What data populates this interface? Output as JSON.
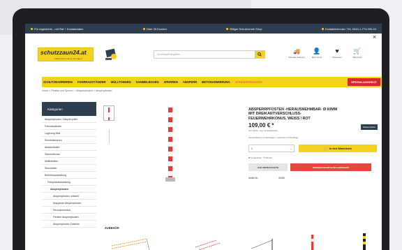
{
  "topbar": {
    "items": [
      "Für registrierte - mit Rat + Kontaktdaten",
      "Über 25 Kunden",
      "Billiger Schutzrunde Shop",
      "Kontaktformular / Tel. 0043-1-774-999-24"
    ]
  },
  "header": {
    "logo_text": "schutzzaun24.at",
    "logo_tagline": "... selbst eine Lösung auf Lager!",
    "search_placeholder": "Suchbegriff eingeben ...",
    "icons": [
      {
        "name": "truck-icon",
        "glyph": "🚚",
        "label": "Schnelle Lieferung"
      },
      {
        "name": "user-icon",
        "glyph": "👤",
        "label": "Mein Konto"
      },
      {
        "name": "heart-icon",
        "glyph": "♥",
        "label": "Merkzettel"
      },
      {
        "name": "cart-icon",
        "glyph": "🛒",
        "label": "Warenkorb"
      }
    ]
  },
  "nav": {
    "items": [
      {
        "label": "SCHUTZBARRIEREN",
        "color": "normal"
      },
      {
        "label": "FAHRRADSTÄNDER",
        "color": "normal"
      },
      {
        "label": "MÜLLTONNEN",
        "color": "normal"
      },
      {
        "label": "SAMMELBOXEN",
        "color": "normal"
      },
      {
        "label": "SPERREN",
        "color": "normal"
      },
      {
        "label": "ABSPERR",
        "color": "normal"
      },
      {
        "label": "BETONARMIERUNG",
        "color": "normal"
      },
      {
        "label": "SONDERKENNUNG",
        "color": "orange"
      }
    ],
    "highlight": "SPEZIALANGEBOT"
  },
  "breadcrumb": "Home  >  Pfosten und Sperren  >  Absperrpfosten  >  Absperrpfosten",
  "sidebar": {
    "title": "Kategorien",
    "items": [
      {
        "label": "Absperrpfosten / Absperrpoller",
        "level": 0
      },
      {
        "label": "Fahrradständer",
        "level": 0
      },
      {
        "label": "Lagerung Müll",
        "level": 0
      },
      {
        "label": "Schutzbarrieren",
        "level": 0
      },
      {
        "label": "Abstandhalter",
        "level": 0
      },
      {
        "label": "Sammelboxen",
        "level": 0
      },
      {
        "label": "Müllbehälter",
        "level": 0
      },
      {
        "label": "Streukisten",
        "level": 0
      },
      {
        "label": "Betriebsausstattung",
        "level": 0
      },
      {
        "label": "Parkplatzausstattung",
        "level": 1
      },
      {
        "label": "Absperrpfosten",
        "level": 2
      },
      {
        "label": "Absperrpfosten rot/weiß",
        "level": 3
      },
      {
        "label": "Klappbare Absperrpfosten",
        "level": 3
      },
      {
        "label": "Herausnehmbar",
        "level": 3
      },
      {
        "label": "Flexible Absperrpfosten",
        "level": 3
      },
      {
        "label": "Absperrpfosten Zubehör",
        "level": 3
      }
    ]
  },
  "product": {
    "title": "ABSPERRPFOSTEN -HERAUSNEHMBAR- Ø 60MM MIT DREIKANTVERSCHLUSS-FEUERWEHRKONUS, WEISS / ROT",
    "badge": "Markenartikel",
    "price": "109,00 € *",
    "tax_note": "inkl. MwSt. zzgl. Versandkosten",
    "availability": "Versandfertig in 2 Werktagen, Lieferzeit 3-5 Werktage",
    "quantity": "1",
    "cart_button": "In den Warenkorb",
    "compare_link": "Vergleichen",
    "wishlist_link": "Merken",
    "button_left": "ZUR ANFRAGELISTE",
    "button_right": "SONDERANFERTIGUNG ANFRAGEN",
    "meta_label": "Artikel-Nr.:",
    "meta_value": "40265",
    "related_heading": "ZUBEHÖR"
  },
  "colors": {
    "brand_yellow": "#f2d21e",
    "navy": "#2e3e4f",
    "accent_red": "#d9262c",
    "cta_red": "#e7473c"
  }
}
